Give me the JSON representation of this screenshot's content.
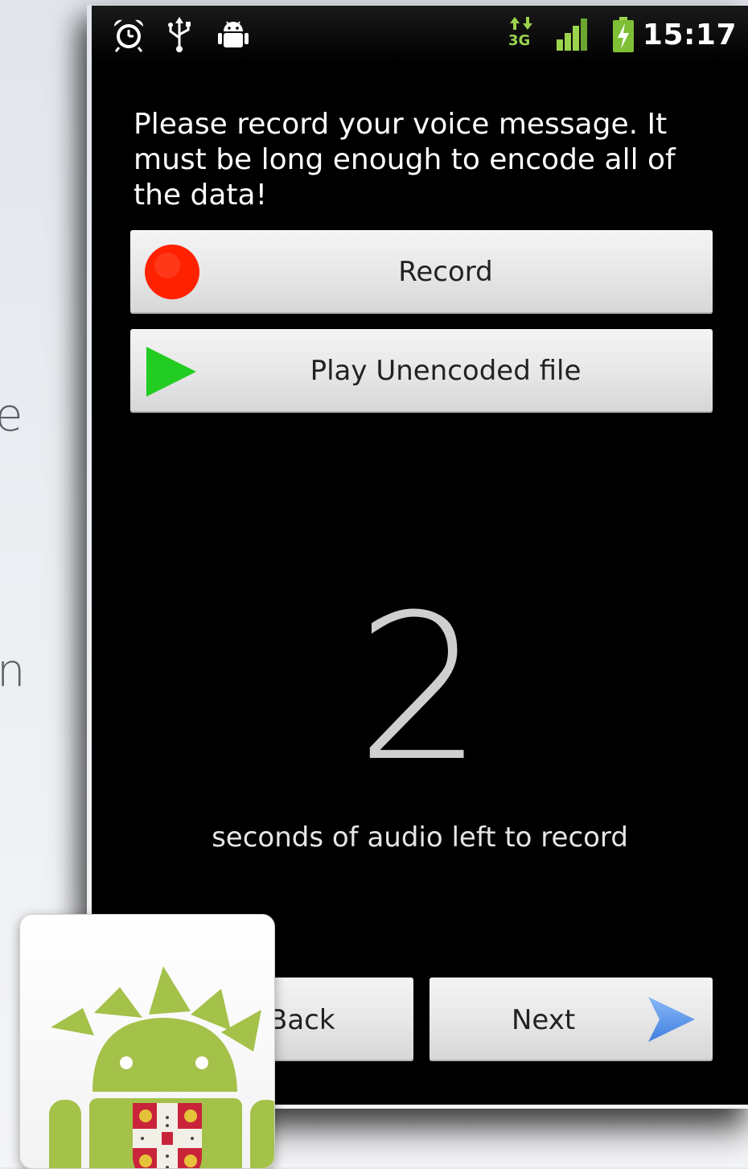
{
  "slide": {
    "fragment_1": "e",
    "fragment_2": "n"
  },
  "status_bar": {
    "time": "15:17",
    "network_label": "3G",
    "icons": [
      "alarm-icon",
      "usb-icon",
      "android-debug-icon",
      "data-activity-icon",
      "signal-strength-icon",
      "battery-charging-icon"
    ]
  },
  "screen": {
    "prompt": "Please record your voice message. It must be long enough to encode all of the data!",
    "record_button": {
      "label": "Record",
      "icon": "record-icon",
      "color": "#ff2200"
    },
    "play_button": {
      "label": "Play Unencoded file",
      "icon": "play-icon",
      "color": "#22cc22"
    },
    "countdown": {
      "value": "2",
      "label": "seconds of audio left to record"
    },
    "back_button": {
      "label": "Back"
    },
    "next_button": {
      "label": "Next",
      "icon": "next-arrow-icon",
      "color": "#5599ee"
    }
  },
  "logo": {
    "name": "app-logo",
    "brand_color": "#a4c14a"
  }
}
